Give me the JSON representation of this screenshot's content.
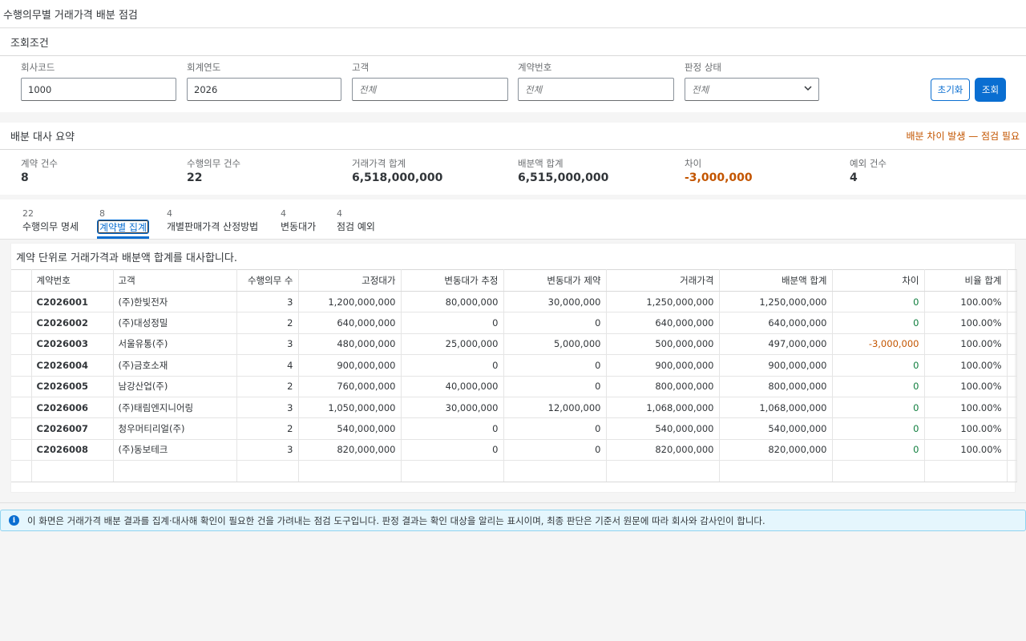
{
  "page": {
    "title": "수행의무별 거래가격 배분 점검"
  },
  "filters": {
    "header": "조회조건",
    "company_code": {
      "label": "회사코드",
      "value": "1000"
    },
    "fiscal_year": {
      "label": "회계연도",
      "value": "2026"
    },
    "customer": {
      "label": "고객",
      "placeholder": "전체"
    },
    "contract_no": {
      "label": "계약번호",
      "placeholder": "전체"
    },
    "judgment": {
      "label": "판정 상태",
      "placeholder": "전체"
    },
    "reset_label": "초기화",
    "search_label": "조회"
  },
  "summary": {
    "header": "배분 대사 요약",
    "warning": "배분 차이 발생 — 점검 필요",
    "metrics": [
      {
        "label": "계약 건수",
        "value": "8"
      },
      {
        "label": "수행의무 건수",
        "value": "22"
      },
      {
        "label": "거래가격 합계",
        "value": "6,518,000,000"
      },
      {
        "label": "배분액 합계",
        "value": "6,515,000,000"
      },
      {
        "label": "차이",
        "value": "-3,000,000"
      },
      {
        "label": "예외 건수",
        "value": "4"
      }
    ]
  },
  "tabs": [
    {
      "count": "22",
      "label": "수행의무 명세"
    },
    {
      "count": "8",
      "label": "계약별 집계"
    },
    {
      "count": "4",
      "label": "개별판매가격 산정방법"
    },
    {
      "count": "4",
      "label": "변동대가"
    },
    {
      "count": "4",
      "label": "점검 예외"
    }
  ],
  "content": {
    "description": "계약 단위로 거래가격과 배분액 합계를 대사합니다.",
    "columns": [
      "계약번호",
      "고객",
      "수행의무 수",
      "고정대가",
      "변동대가 추정",
      "변동대가 제약",
      "거래가격",
      "배분액 합계",
      "차이",
      "비율 합계"
    ],
    "rows": [
      [
        "C2026001",
        "(주)한빛전자",
        "3",
        "1,200,000,000",
        "80,000,000",
        "30,000,000",
        "1,250,000,000",
        "1,250,000,000",
        "0",
        "100.00%"
      ],
      [
        "C2026002",
        "(주)대성정밀",
        "2",
        "640,000,000",
        "0",
        "0",
        "640,000,000",
        "640,000,000",
        "0",
        "100.00%"
      ],
      [
        "C2026003",
        "서울유통(주)",
        "3",
        "480,000,000",
        "25,000,000",
        "5,000,000",
        "500,000,000",
        "497,000,000",
        "-3,000,000",
        "100.00%"
      ],
      [
        "C2026004",
        "(주)금호소재",
        "4",
        "900,000,000",
        "0",
        "0",
        "900,000,000",
        "900,000,000",
        "0",
        "100.00%"
      ],
      [
        "C2026005",
        "남강산업(주)",
        "2",
        "760,000,000",
        "40,000,000",
        "0",
        "800,000,000",
        "800,000,000",
        "0",
        "100.00%"
      ],
      [
        "C2026006",
        "(주)태림엔지니어링",
        "3",
        "1,050,000,000",
        "30,000,000",
        "12,000,000",
        "1,068,000,000",
        "1,068,000,000",
        "0",
        "100.00%"
      ],
      [
        "C2026007",
        "청우머티리얼(주)",
        "2",
        "540,000,000",
        "0",
        "0",
        "540,000,000",
        "540,000,000",
        "0",
        "100.00%"
      ],
      [
        "C2026008",
        "(주)동보테크",
        "3",
        "820,000,000",
        "0",
        "0",
        "820,000,000",
        "820,000,000",
        "0",
        "100.00%"
      ]
    ]
  },
  "info": {
    "icon": "info-icon",
    "text": "이 화면은 거래가격 배분 결과를 집계·대사해 확인이 필요한 건을 가려내는 점검 도구입니다. 판정 결과는 확인 대상을 알리는 표시이며, 최종 판단은 기준서 원문에 따라 회사와 감사인이 합니다."
  },
  "colors": {
    "accent": "#0a6ed1",
    "warning": "#c35500",
    "positive": "#107e3e",
    "info_bg": "#e5f6fd"
  }
}
